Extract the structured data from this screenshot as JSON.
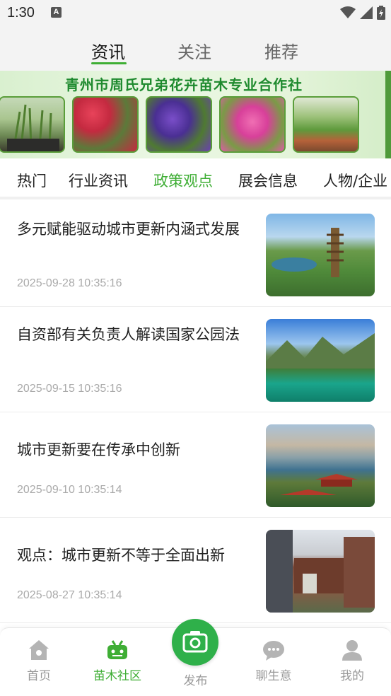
{
  "status_bar": {
    "time": "1:30",
    "notification_letter": "A"
  },
  "top_tabs": [
    {
      "label": "资讯",
      "active": true
    },
    {
      "label": "关注",
      "active": false
    },
    {
      "label": "推荐",
      "active": false
    }
  ],
  "banner": {
    "title": "青州市周氏兄弟花卉苗木专业合作社"
  },
  "category_tabs": [
    {
      "label": "热门",
      "active": false
    },
    {
      "label": "行业资讯",
      "active": false
    },
    {
      "label": "政策观点",
      "active": true
    },
    {
      "label": "展会信息",
      "active": false
    },
    {
      "label": "人物/企业",
      "active": false
    }
  ],
  "news": [
    {
      "title": "多元赋能驱动城市更新内涵式发展",
      "date": "2025-09-28 10:35:16"
    },
    {
      "title": "自资部有关负责人解读国家公园法",
      "date": "2025-09-15 10:35:16"
    },
    {
      "title": "城市更新要在传承中创新",
      "date": "2025-09-10 10:35:14"
    },
    {
      "title": "观点：城市更新不等于全面出新",
      "date": "2025-08-27 10:35:14"
    }
  ],
  "bottom_nav": [
    {
      "label": "首页",
      "icon": "home-icon",
      "active": false
    },
    {
      "label": "苗木社区",
      "icon": "community-icon",
      "active": true
    },
    {
      "label": "发布",
      "icon": "camera-icon",
      "active": false
    },
    {
      "label": "聊生意",
      "icon": "chat-icon",
      "active": false
    },
    {
      "label": "我的",
      "icon": "user-icon",
      "active": false
    }
  ],
  "colors": {
    "accent": "#3fae35",
    "publish": "#2fb04a",
    "inactive": "#999999"
  }
}
